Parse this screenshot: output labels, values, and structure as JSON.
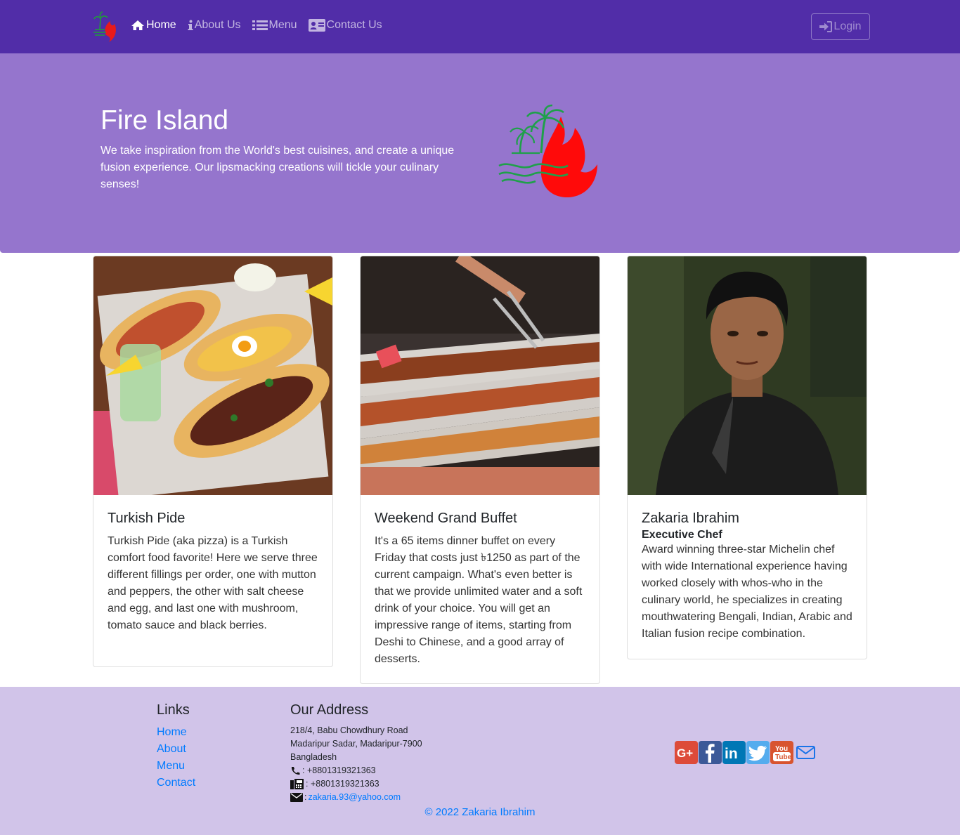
{
  "nav": {
    "items": [
      {
        "label": "Home",
        "icon": "home-icon"
      },
      {
        "label": "About Us",
        "icon": "info-icon"
      },
      {
        "label": "Menu",
        "icon": "list-icon"
      },
      {
        "label": "Contact Us",
        "icon": "address-card-icon"
      }
    ],
    "login_label": "Login"
  },
  "jumbotron": {
    "title": "Fire Island",
    "text": "We take inspiration from the World's best cuisines, and create a unique fusion experience. Our lipsmacking creations will tickle your culinary senses!"
  },
  "cards": [
    {
      "title": "Turkish Pide",
      "subtitle": "",
      "text": "Turkish Pide (aka pizza) is a Turkish comfort food favorite! Here we serve three different fillings per order, one with mutton and peppers, the other with salt cheese and egg, and last one with mushroom, tomato sauce and black berries."
    },
    {
      "title": "Weekend Grand Buffet",
      "subtitle": "",
      "text": "It's a 65 items dinner buffet on every Friday that costs just ৳1250 as part of the current campaign. What's even better is that we provide unlimited water and a soft drink of your choice. You will get an impressive range of items, starting from Deshi to Chinese, and a good array of desserts."
    },
    {
      "title": "Zakaria Ibrahim",
      "subtitle": "Executive Chef",
      "text": "Award winning three-star Michelin chef with wide International experience having worked closely with whos-who in the culinary world, he specializes in creating mouthwatering Bengali, Indian, Arabic and Italian fusion recipe combination."
    }
  ],
  "footer": {
    "links_heading": "Links",
    "links": [
      "Home",
      "About",
      "Menu",
      "Contact"
    ],
    "address_heading": "Our Address",
    "address_lines": [
      "218/4, Babu Chowdhury Road",
      "Madaripur Sadar, Madaripur-7900",
      "Bangladesh"
    ],
    "phone": ": +8801319321363",
    "fax": ": +8801319321363",
    "email_prefix": ": ",
    "email": "zakaria.93@yahoo.com",
    "social": [
      "google-plus-icon",
      "facebook-icon",
      "linkedin-icon",
      "twitter-icon",
      "youtube-icon",
      "mail-icon"
    ],
    "copyright": "© 2022 Zakaria Ibrahim"
  },
  "colors": {
    "primary": "#512DA8",
    "jumbotron": "#9575CD",
    "footer": "#D1C4E9",
    "link": "#007bff"
  }
}
